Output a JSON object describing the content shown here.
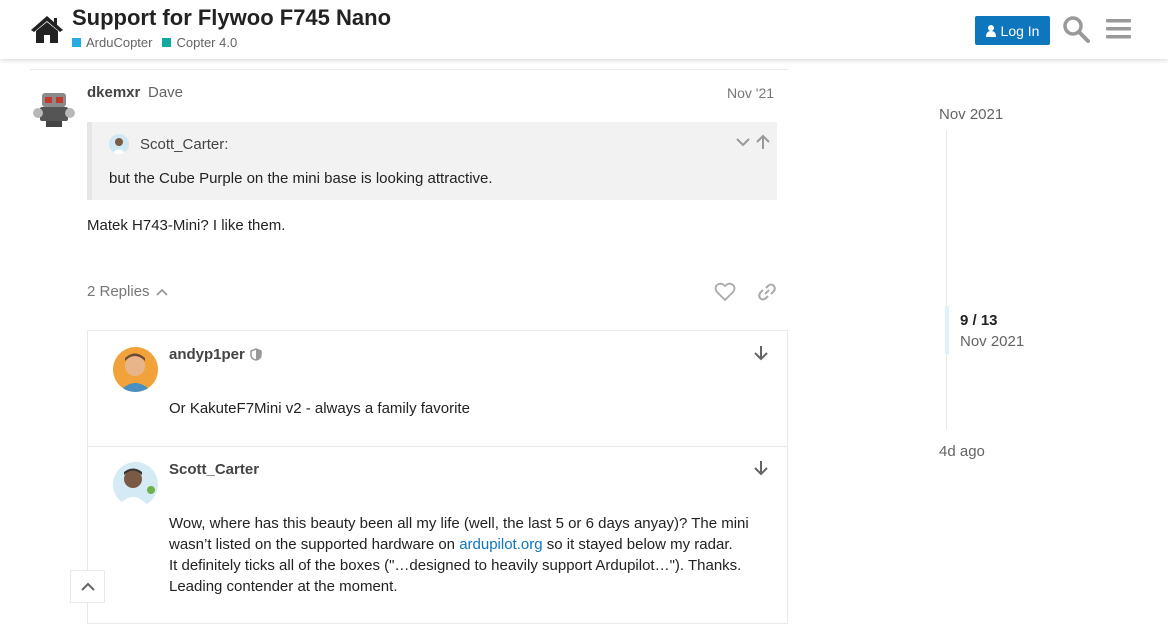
{
  "header": {
    "title": "Support for Flywoo F745 Nano",
    "categories": [
      {
        "label": "ArduCopter",
        "color": "#25aae1"
      },
      {
        "label": "Copter 4.0",
        "color": "#12a89d"
      }
    ],
    "login_label": "Log In"
  },
  "post": {
    "username": "dkemxr",
    "full_name": "Dave",
    "date": "Nov '21",
    "quote": {
      "username": "Scott_Carter:",
      "text": "but the Cube Purple on the mini base is looking attractive."
    },
    "body": "Matek H743-Mini? I like them.",
    "replies_label": "2 Replies"
  },
  "replies": [
    {
      "username": "andyp1per",
      "lines": [
        "Or KakuteF7Mini v2 - always a family favorite"
      ]
    },
    {
      "username": "Scott_Carter",
      "line1": "Wow, where has this beauty been all my life (well, the last 5 or 6 days anyay)? The mini",
      "line2_before": "wasn’t listed on the supported hardware on ",
      "line2_link": "ardupilot.org",
      "line2_after": " so it stayed below my radar.",
      "line3": "It definitely ticks all of the boxes (\"…designed to heavily support Ardupilot…\"). Thanks.",
      "line4": "Leading contender at the moment."
    }
  ],
  "timeline": {
    "start_date": "Nov 2021",
    "position": "9 / 13",
    "current_date": "Nov 2021",
    "end_label": "4d ago"
  },
  "colors": {
    "primary": "#0e76bd",
    "highlight": "#dff1fb"
  }
}
